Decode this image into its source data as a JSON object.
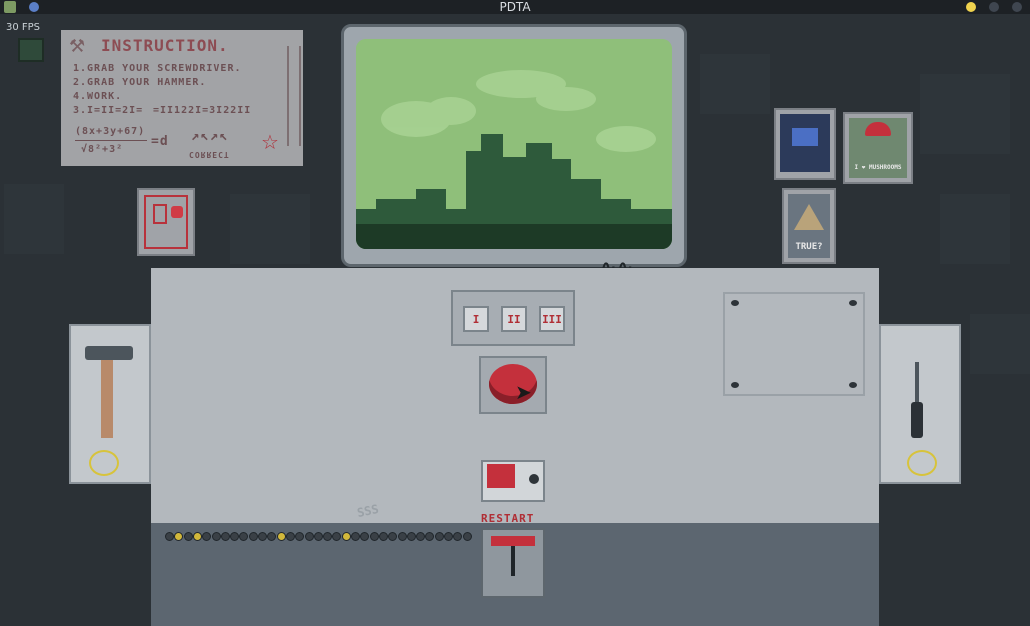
{
  "window": {
    "title": "PDTA"
  },
  "hud": {
    "fps": "30 FPS"
  },
  "instruction": {
    "title": "INSTRUCTION.",
    "lines": [
      "1.GRAB YOUR SCREWDRIVER.",
      "2.GRAB YOUR HAMMER.",
      "4.WORK.",
      "3.I=II=2I=",
      "=II122I=3I22II"
    ],
    "formula": "(8x+3y+67)",
    "formula_tail": "=d",
    "formula_denom": "√8²+3²",
    "code_label": "CORRECT"
  },
  "posters": {
    "mushroom_caption": "I ❤ MUSHROOMS",
    "pyramid_caption": "TRUE?"
  },
  "console": {
    "speed_buttons": [
      "I",
      "II",
      "III"
    ],
    "restart_label": "RESTART",
    "scribble": "SSS",
    "leds": [
      0,
      1,
      0,
      1,
      0,
      0,
      0,
      0,
      0,
      0,
      0,
      0,
      1,
      0,
      0,
      0,
      0,
      0,
      0,
      1,
      0,
      0,
      0,
      0,
      0,
      0,
      0,
      0,
      0,
      0,
      0,
      0,
      0
    ]
  },
  "colors": {
    "accent_red": "#c4303c",
    "screen_green": "#8fbf7a",
    "led_on": "#d2b83b"
  }
}
